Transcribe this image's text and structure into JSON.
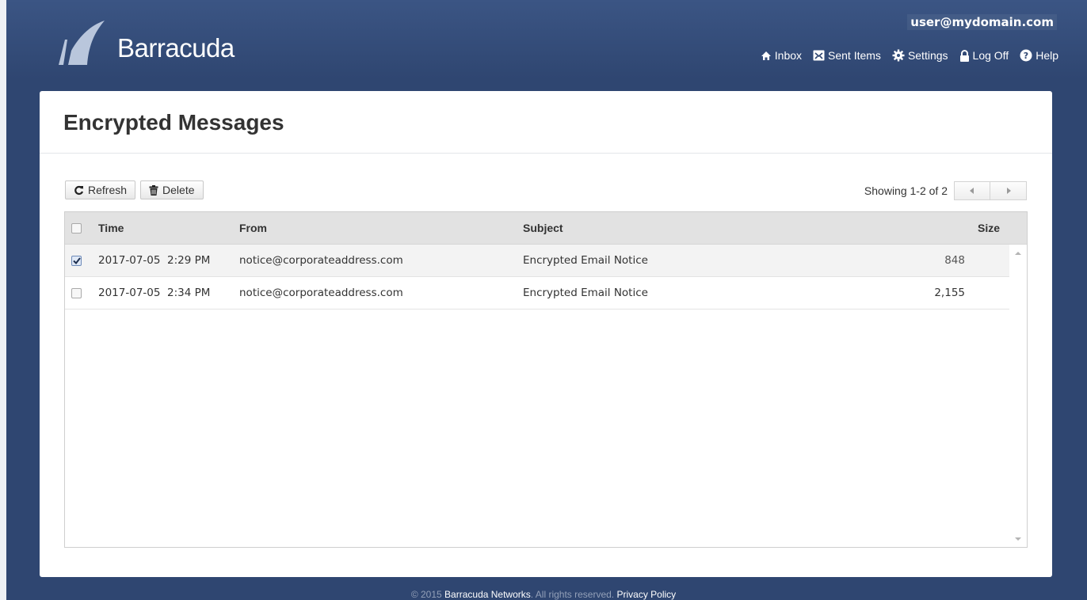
{
  "brand": {
    "name": "Barracuda"
  },
  "header": {
    "user_email": "user@mydomain.com",
    "nav": [
      {
        "label": "Inbox",
        "icon": "home-icon"
      },
      {
        "label": "Sent Items",
        "icon": "envelope-icon"
      },
      {
        "label": "Settings",
        "icon": "gear-icon"
      },
      {
        "label": "Log Off",
        "icon": "lock-icon"
      },
      {
        "label": "Help",
        "icon": "help-icon"
      }
    ]
  },
  "page": {
    "title": "Encrypted Messages"
  },
  "toolbar": {
    "refresh_label": "Refresh",
    "delete_label": "Delete",
    "paging_text": "Showing 1-2 of 2"
  },
  "table": {
    "columns": {
      "time": "Time",
      "from": "From",
      "subject": "Subject",
      "size": "Size"
    },
    "rows": [
      {
        "checked": true,
        "time": "2017-07-05  2:29 PM",
        "from": "notice@corporateaddress.com",
        "subject": "Encrypted Email Notice",
        "size": "848"
      },
      {
        "checked": false,
        "time": "2017-07-05  2:34 PM",
        "from": "notice@corporateaddress.com",
        "subject": "Encrypted Email Notice",
        "size": "2,155"
      }
    ]
  },
  "footer": {
    "copyright": "© 2015",
    "company": "Barracuda Networks",
    "rights": ". All rights reserved.",
    "privacy": "Privacy Policy"
  },
  "colors": {
    "background": "#2f4671",
    "header": "#3b5584",
    "card": "#ffffff",
    "table_header": "#e2e2e2"
  }
}
